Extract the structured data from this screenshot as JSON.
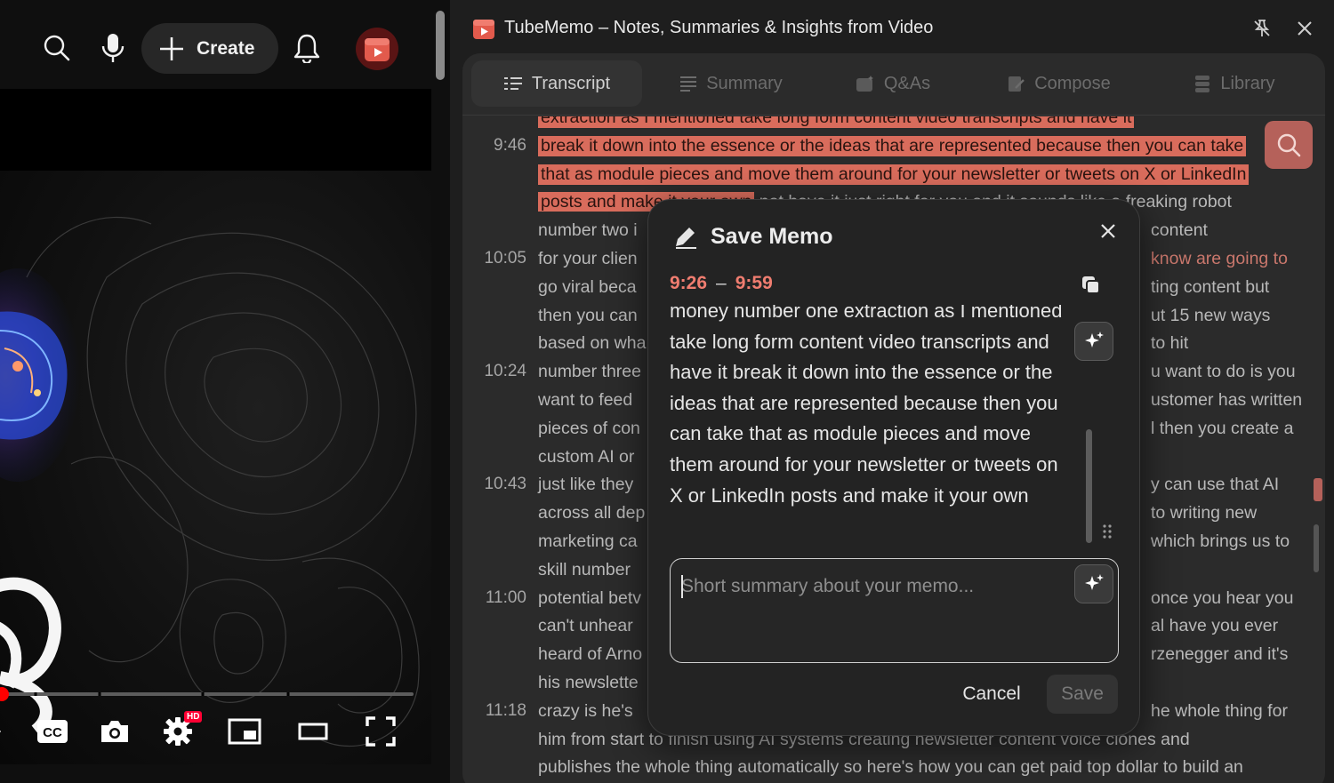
{
  "youtube": {
    "create_label": "Create",
    "hd_badge": "HD",
    "icons": [
      "search-icon",
      "mic-icon",
      "bell-icon",
      "avatar",
      "cc-icon",
      "camera-icon",
      "settings-icon",
      "miniplayer-icon",
      "theater-icon",
      "fullscreen-icon"
    ],
    "progress_fraction": 0.01
  },
  "panel": {
    "title": "TubeMemo – Notes, Summaries & Insights from Video",
    "tabs": [
      {
        "label": "Transcript",
        "active": true
      },
      {
        "label": "Summary",
        "active": false
      },
      {
        "label": "Q&As",
        "active": false
      },
      {
        "label": "Compose",
        "active": false
      },
      {
        "label": "Library",
        "active": false
      }
    ],
    "transcript": [
      {
        "time": "",
        "text": "extraction as I mentioned take long form content video transcripts and have it",
        "highlight": true
      },
      {
        "time": "9:46",
        "text": "break it down into the essence or the ideas that are represented because then you can take",
        "highlight": true
      },
      {
        "time": "",
        "text": "that as module pieces and move them around for your newsletter or tweets on X or LinkedIn",
        "highlight": true
      },
      {
        "time": "",
        "text_hl": "posts and make it your own",
        "text": " not have it just right for you and it sounds like a freaking robot",
        "highlight": "partial"
      },
      {
        "time": "",
        "text": "number two i",
        "right": "content"
      },
      {
        "time": "10:05",
        "text": "for your clien",
        "right": "know are going to"
      },
      {
        "time": "",
        "text": "go viral beca",
        "right": "ting content but"
      },
      {
        "time": "",
        "text": "then you can",
        "right": "ut 15 new ways"
      },
      {
        "time": "",
        "text": "based on wha",
        "right": "to hit"
      },
      {
        "time": "10:24",
        "text": "number three",
        "right": "u want to do is you"
      },
      {
        "time": "",
        "text": "want to feed",
        "right": "ustomer has written"
      },
      {
        "time": "",
        "text": "pieces of con",
        "right": "l then you create a"
      },
      {
        "time": "",
        "text": "custom AI or",
        "right": ""
      },
      {
        "time": "10:43",
        "text": "just like they",
        "right": "y can use that AI"
      },
      {
        "time": "",
        "text": "across all dep",
        "right": "to writing new"
      },
      {
        "time": "",
        "text": "marketing ca",
        "right": "which brings us to"
      },
      {
        "time": "",
        "text": "skill number",
        "right": ""
      },
      {
        "time": "11:00",
        "text": "potential betv",
        "right": "once you hear you"
      },
      {
        "time": "",
        "text": "can't unhear",
        "right": "al have you ever"
      },
      {
        "time": "",
        "text": "heard of Arno",
        "right": "rzenegger and it's"
      },
      {
        "time": "",
        "text": "his newslette",
        "right": ""
      },
      {
        "time": "11:18",
        "text": "crazy is he's",
        "right": "he whole thing for"
      },
      {
        "time": "",
        "text": "him from start to finish using AI systems creating newsletter content voice clones and"
      },
      {
        "time": "",
        "text": "publishes the whole thing automatically so here's how you can get paid top dollar to build an"
      }
    ]
  },
  "modal": {
    "title": "Save Memo",
    "start": "9:26",
    "dash": "–",
    "end": "9:59",
    "memo_text": "money number one extraction as I mentioned take long form content video transcripts and have it break it down into the essence or the ideas that are represented because then you can take that as module pieces and move them around for your newsletter or tweets on X or LinkedIn posts and make it your own",
    "summary_placeholder": "Short summary about your memo...",
    "summary_value": "",
    "cancel_label": "Cancel",
    "save_label": "Save"
  },
  "colors": {
    "accent": "#f07d70",
    "highlight": "#d96c5c",
    "search_button": "#b5615a",
    "youtube_red": "#ff0000"
  }
}
